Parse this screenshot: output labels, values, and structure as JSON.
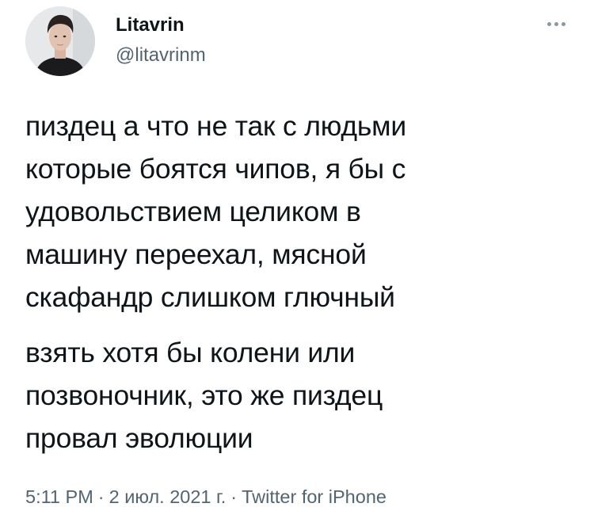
{
  "author": {
    "display_name": "Litavrin",
    "handle": "@litavrinm",
    "avatar": "profile-photo"
  },
  "more_icon": "ellipsis-icon",
  "tweet": {
    "paragraphs": [
      "пиздец а что не так с людьми которые боятся чипов, я бы с удовольствием целиком в машину переехал, мясной скафандр слишком глючный",
      "взять хотя бы колени или позвоночник, это же пиздец провал эволюции"
    ],
    "lines": [
      "пиздец а что не так с людьми",
      "которые боятся чипов, я бы с",
      "удовольствием целиком в",
      "машину переехал, мясной",
      "скафандр слишком глючный",
      "взять хотя бы колени или",
      "позвоночник, это же пиздец",
      "провал эволюции"
    ]
  },
  "meta": {
    "time": "5:11 PM",
    "separator": "·",
    "date": "2 июл. 2021 г.",
    "source": "Twitter for iPhone"
  },
  "colors": {
    "text": "#0f1419",
    "secondary": "#536471",
    "background": "#ffffff"
  }
}
